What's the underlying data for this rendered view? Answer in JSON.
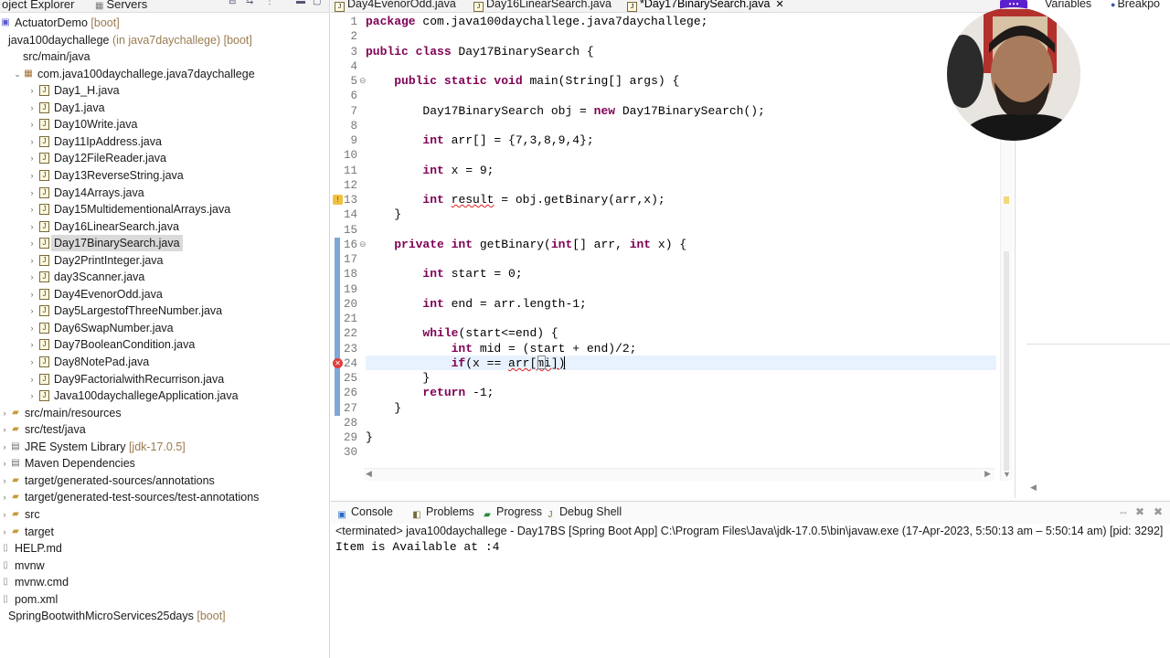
{
  "explorer": {
    "tabs": [
      "oject Explorer",
      "Servers"
    ],
    "items": [
      {
        "label": "ActuatorDemo",
        "deco": "[boot]",
        "indent": 0,
        "icon": "proj",
        "arrow": ""
      },
      {
        "label": "java100daychallege",
        "deco": "(in java7daychallege) [boot]",
        "indent": 0,
        "icon": "",
        "arrow": ""
      },
      {
        "label": "src/main/java",
        "deco": "",
        "indent": 1,
        "icon": "",
        "arrow": ""
      },
      {
        "label": "com.java100daychallege.java7daychallege",
        "deco": "",
        "indent": 1,
        "icon": "pkg",
        "arrow": "v"
      },
      {
        "label": "Day1_H.java",
        "deco": "",
        "indent": 2,
        "icon": "java",
        "arrow": ">"
      },
      {
        "label": "Day1.java",
        "deco": "",
        "indent": 2,
        "icon": "java",
        "arrow": ">"
      },
      {
        "label": "Day10Write.java",
        "deco": "",
        "indent": 2,
        "icon": "java",
        "arrow": ">"
      },
      {
        "label": "Day11IpAddress.java",
        "deco": "",
        "indent": 2,
        "icon": "java",
        "arrow": ">"
      },
      {
        "label": "Day12FileReader.java",
        "deco": "",
        "indent": 2,
        "icon": "java",
        "arrow": ">"
      },
      {
        "label": "Day13ReverseString.java",
        "deco": "",
        "indent": 2,
        "icon": "java",
        "arrow": ">"
      },
      {
        "label": "Day14Arrays.java",
        "deco": "",
        "indent": 2,
        "icon": "java",
        "arrow": ">"
      },
      {
        "label": "Day15MultidementionalArrays.java",
        "deco": "",
        "indent": 2,
        "icon": "java",
        "arrow": ">"
      },
      {
        "label": "Day16LinearSearch.java",
        "deco": "",
        "indent": 2,
        "icon": "java",
        "arrow": ">"
      },
      {
        "label": "Day17BinarySearch.java",
        "deco": "",
        "indent": 2,
        "icon": "java",
        "arrow": ">",
        "selected": true
      },
      {
        "label": "Day2PrintInteger.java",
        "deco": "",
        "indent": 2,
        "icon": "java",
        "arrow": ">"
      },
      {
        "label": "day3Scanner.java",
        "deco": "",
        "indent": 2,
        "icon": "java",
        "arrow": ">"
      },
      {
        "label": "Day4EvenorOdd.java",
        "deco": "",
        "indent": 2,
        "icon": "java",
        "arrow": ">"
      },
      {
        "label": "Day5LargestofThreeNumber.java",
        "deco": "",
        "indent": 2,
        "icon": "java",
        "arrow": ">"
      },
      {
        "label": "Day6SwapNumber.java",
        "deco": "",
        "indent": 2,
        "icon": "java",
        "arrow": ">"
      },
      {
        "label": "Day7BooleanCondition.java",
        "deco": "",
        "indent": 2,
        "icon": "java",
        "arrow": ">"
      },
      {
        "label": "Day8NotePad.java",
        "deco": "",
        "indent": 2,
        "icon": "java",
        "arrow": ">"
      },
      {
        "label": "Day9FactorialwithRecurrison.java",
        "deco": "",
        "indent": 2,
        "icon": "java",
        "arrow": ">"
      },
      {
        "label": "Java100daychallegeApplication.java",
        "deco": "",
        "indent": 2,
        "icon": "java",
        "arrow": ">"
      },
      {
        "label": "src/main/resources",
        "deco": "",
        "indent": 0,
        "icon": "folder",
        "arrow": ">"
      },
      {
        "label": "src/test/java",
        "deco": "",
        "indent": 0,
        "icon": "folder",
        "arrow": ">"
      },
      {
        "label": "JRE System Library",
        "deco": "[jdk-17.0.5]",
        "indent": 0,
        "icon": "lib",
        "arrow": ">"
      },
      {
        "label": "Maven Dependencies",
        "deco": "",
        "indent": 0,
        "icon": "lib",
        "arrow": ">"
      },
      {
        "label": "target/generated-sources/annotations",
        "deco": "",
        "indent": 0,
        "icon": "folder",
        "arrow": ">"
      },
      {
        "label": "target/generated-test-sources/test-annotations",
        "deco": "",
        "indent": 0,
        "icon": "folder",
        "arrow": ">"
      },
      {
        "label": "src",
        "deco": "",
        "indent": 0,
        "icon": "folder",
        "arrow": ">"
      },
      {
        "label": "target",
        "deco": "",
        "indent": 0,
        "icon": "folder",
        "arrow": ">"
      },
      {
        "label": "HELP.md",
        "deco": "",
        "indent": 0,
        "icon": "file",
        "arrow": ""
      },
      {
        "label": "mvnw",
        "deco": "",
        "indent": 0,
        "icon": "file",
        "arrow": ""
      },
      {
        "label": "mvnw.cmd",
        "deco": "",
        "indent": 0,
        "icon": "file",
        "arrow": ""
      },
      {
        "label": "pom.xml",
        "deco": "",
        "indent": 0,
        "icon": "file",
        "arrow": ""
      },
      {
        "label": "SpringBootwithMicroServices25days",
        "deco": "[boot]",
        "indent": 0,
        "icon": "",
        "arrow": ""
      }
    ]
  },
  "editor": {
    "tabs": [
      {
        "label": "Day4EvenorOdd.java",
        "active": false,
        "close": ""
      },
      {
        "label": "Day16LinearSearch.java",
        "active": false,
        "close": ""
      },
      {
        "label": "*Day17BinarySearch.java",
        "active": true,
        "close": "✕"
      }
    ],
    "line_numbers": [
      "1",
      "2",
      "3",
      "4",
      "5",
      "6",
      "7",
      "8",
      "9",
      "10",
      "11",
      "12",
      "13",
      "14",
      "15",
      "16",
      "17",
      "18",
      "19",
      "20",
      "21",
      "22",
      "23",
      "24",
      "25",
      "26",
      "27",
      "28",
      "29",
      "30"
    ],
    "code": [
      [
        {
          "k": 1,
          "t": "package"
        },
        {
          "t": " com.java100daychallege.java7daychallege;"
        }
      ],
      [],
      [
        {
          "k": 1,
          "t": "public class"
        },
        {
          "t": " Day17BinarySearch {"
        }
      ],
      [],
      [
        {
          "t": "    "
        },
        {
          "k": 1,
          "t": "public static void"
        },
        {
          "t": " main(String[] args) {"
        }
      ],
      [],
      [
        {
          "t": "        Day17BinarySearch obj = "
        },
        {
          "k": 1,
          "t": "new"
        },
        {
          "t": " Day17BinarySearch();"
        }
      ],
      [],
      [
        {
          "t": "        "
        },
        {
          "k": 1,
          "t": "int"
        },
        {
          "t": " arr[] = {7,3,8,9,4};"
        }
      ],
      [],
      [
        {
          "t": "        "
        },
        {
          "k": 1,
          "t": "int"
        },
        {
          "t": " x = 9;"
        }
      ],
      [],
      [
        {
          "t": "        "
        },
        {
          "k": 1,
          "t": "int"
        },
        {
          "t": " "
        },
        {
          "e": 1,
          "t": "result"
        },
        {
          "t": " = obj.getBinary(arr,x);"
        }
      ],
      [
        {
          "t": "    }"
        }
      ],
      [],
      [
        {
          "t": "    "
        },
        {
          "k": 1,
          "t": "private int"
        },
        {
          "t": " getBinary("
        },
        {
          "k": 1,
          "t": "int"
        },
        {
          "t": "[] arr, "
        },
        {
          "k": 1,
          "t": "int"
        },
        {
          "t": " x) {"
        }
      ],
      [],
      [
        {
          "t": "        "
        },
        {
          "k": 1,
          "t": "int"
        },
        {
          "t": " start = 0;"
        }
      ],
      [],
      [
        {
          "t": "        "
        },
        {
          "k": 1,
          "t": "int"
        },
        {
          "t": " end = arr.length-1;"
        }
      ],
      [],
      [
        {
          "t": "        "
        },
        {
          "k": 1,
          "t": "while"
        },
        {
          "t": "(start<=end) {"
        }
      ],
      [
        {
          "t": "            "
        },
        {
          "k": 1,
          "t": "int"
        },
        {
          "t": " mid = (start + end)/2;"
        }
      ],
      [
        {
          "t": "            "
        },
        {
          "k": 1,
          "t": "if"
        },
        {
          "t": "(x == "
        },
        {
          "e": 1,
          "t": "arr[mi])"
        }
      ],
      [
        {
          "t": "        }"
        }
      ],
      [
        {
          "t": "        "
        },
        {
          "k": 1,
          "t": "return"
        },
        {
          "t": " -1;"
        }
      ],
      [
        {
          "t": "    }"
        }
      ],
      [],
      [
        {
          "t": "}"
        }
      ],
      []
    ]
  },
  "right_panel": {
    "tabs": [
      "Variables",
      "Breakpo"
    ]
  },
  "more_chip": "⋯",
  "console": {
    "tabs": [
      "Console",
      "Problems",
      "Progress",
      "Debug Shell"
    ],
    "terminated": "<terminated> java100daychallege - Day17BS [Spring Boot App] C:\\Program Files\\Java\\jdk-17.0.5\\bin\\javaw.exe  (17-Apr-2023, 5:50:13 am – 5:50:14 am) [pid: 3292]",
    "output": "Item is Available at :4"
  },
  "colors": {
    "keyword": "#7f0055",
    "error": "#e02020",
    "selection": "#dadada",
    "current_line": "#e8f2fe",
    "accent": "#5a1fcf"
  }
}
